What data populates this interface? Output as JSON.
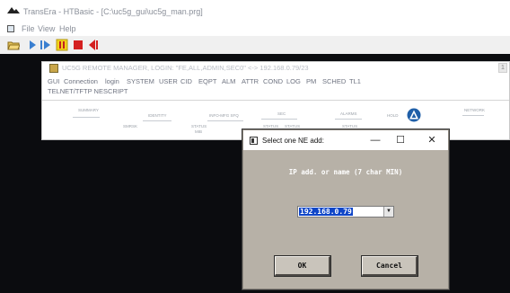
{
  "app": {
    "title": "TransEra - HTBasic - [C:\\uc5g_gui\\uc5g_man.prg]",
    "menu": [
      "File",
      "View",
      "Help"
    ]
  },
  "toolbar": {
    "icons": [
      "open-folder-icon",
      "run-icon",
      "continue-icon",
      "pause-icon",
      "stop-icon",
      "step-back-icon"
    ]
  },
  "inner_window": {
    "title": "UC5G REMOTE MANAGER, LOGIN: \"FE,ALL,ADMIN,SEC0\" <-> 192.168.0.79/23",
    "menu_row1": [
      "GUI",
      "Connection",
      "login",
      "SYSTEM",
      "USER",
      "CID",
      "EQPT",
      "ALM",
      "ATTR",
      "COND",
      "LOG",
      "PM",
      "SCHED",
      "TL1"
    ],
    "menu_row2": [
      "TELNET/TFTP NE",
      "SCRIPT"
    ],
    "toolbar_labels": [
      "SUMMARY",
      "SMRSK",
      "IDENTITY",
      "STATUS",
      "MIB",
      "INFO-MFG SFQ",
      "SEC",
      "STATUS",
      "STATUS",
      "ALARMS",
      "STATUS",
      "HOLD",
      "NETWORK"
    ]
  },
  "dialog": {
    "title": "Select one NE add:",
    "prompt": "IP add. or name (7 char MIN)",
    "selected_value": "192.168.0.79",
    "ok_label": "OK",
    "cancel_label": "Cancel",
    "minimize_glyph": "—",
    "maximize_glyph": "☐",
    "close_glyph": "✕",
    "combo_arrow": "▼"
  }
}
